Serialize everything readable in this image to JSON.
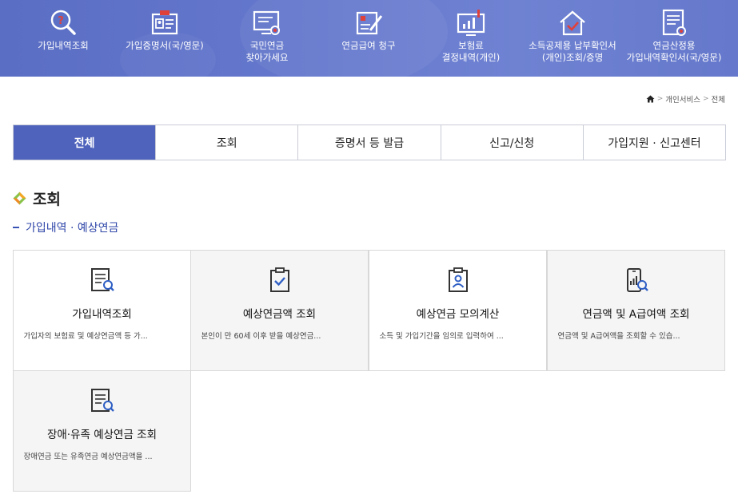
{
  "quick_menu": [
    {
      "label": "가입내역조회",
      "icon": "search-question-icon"
    },
    {
      "label": "가입증명서(국/영문)",
      "icon": "id-card-icon"
    },
    {
      "label": "국민연금\n찾아가세요",
      "icon": "monitor-search-icon"
    },
    {
      "label": "연금급여 청구",
      "icon": "form-pen-icon"
    },
    {
      "label": "보험료\n결정내역(개인)",
      "icon": "chart-screen-icon"
    },
    {
      "label": "소득공제용 납부확인서\n(개인)조회/증명",
      "icon": "house-check-icon"
    },
    {
      "label": "연금산정용\n가입내역확인서(국/영문)",
      "icon": "document-search-icon"
    }
  ],
  "breadcrumb": {
    "home_icon": "home-icon",
    "items": [
      "개인서비스",
      "전체"
    ]
  },
  "tabs": [
    {
      "label": "전체",
      "active": true
    },
    {
      "label": "조회",
      "active": false
    },
    {
      "label": "증명서 등 발급",
      "active": false
    },
    {
      "label": "신고/신청",
      "active": false
    },
    {
      "label": "가입지원 · 신고센터",
      "active": false
    }
  ],
  "section": {
    "title": "조회",
    "subtitle": "가입내역 · 예상연금"
  },
  "cards": [
    {
      "title": "가입내역조회",
      "desc": "가입자의 보험료 및 예상연금액 등 가...",
      "icon": "document-search-icon"
    },
    {
      "title": "예상연금액 조회",
      "desc": "본인이 만 60세 이후 받을 예상연금...",
      "icon": "clipboard-check-icon"
    },
    {
      "title": "예상연금 모의계산",
      "desc": "소득 및 가입기간을 임의로 입력하여 ...",
      "icon": "clipboard-person-icon"
    },
    {
      "title": "연금액 및 A급여액 조회",
      "desc": "연금액 및 A급여액을 조회할 수 있습...",
      "icon": "phone-chart-search-icon"
    },
    {
      "title": "장애·유족 예상연금 조회",
      "desc": "장애연금 또는 유족연금 예상연금액을 ...",
      "icon": "document-search-icon"
    }
  ],
  "colors": {
    "banner": "#6477cc",
    "active_tab": "#4f63bd",
    "subtitle": "#2f46a8",
    "card_bg": "#f5f5f5"
  }
}
